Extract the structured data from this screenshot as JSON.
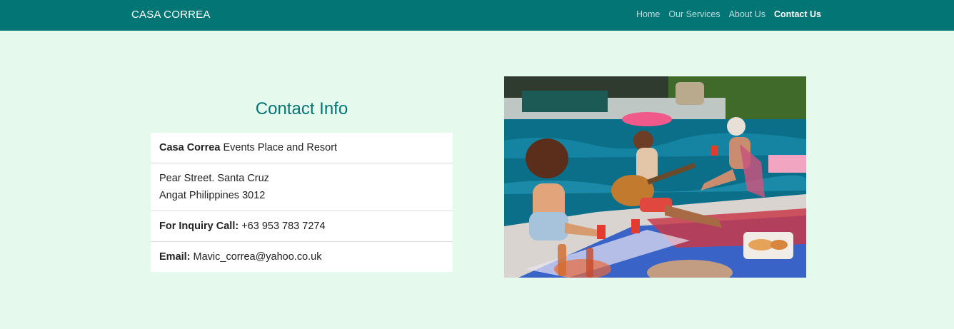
{
  "navbar": {
    "brand": "CASA CORREA",
    "links": [
      {
        "label": "Home",
        "active": false
      },
      {
        "label": "Our Services",
        "active": false
      },
      {
        "label": "About Us",
        "active": false
      },
      {
        "label": "Contact Us",
        "active": true
      }
    ]
  },
  "contact": {
    "title": "Contact Info",
    "name_bold": "Casa Correa",
    "name_rest": " Events Place and Resort",
    "address_line1": "Pear Street. Santa Cruz",
    "address_line2": "Angat Philippines 3012",
    "phone_label": "For Inquiry Call:",
    "phone_value": " +63 953 783 7274",
    "email_label": "Email:",
    "email_value": " Mavic_correa@yahoo.co.uk"
  },
  "colors": {
    "navbar_bg": "#037575",
    "page_bg": "#e5f9ed",
    "title_color": "#037575"
  }
}
